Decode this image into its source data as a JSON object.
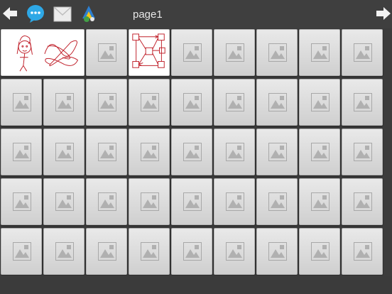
{
  "toolbar": {
    "page_label": "page1",
    "icons": [
      "back-arrow-icon",
      "chat-bubble-icon",
      "mail-icon",
      "share-icon",
      "forward-arrow-icon"
    ],
    "colors": {
      "chat": "#2ea8e6",
      "background": "#3f3f3f"
    }
  },
  "grid": {
    "rows": 5,
    "columns": 9,
    "filled_cells": [
      {
        "row": 0,
        "kind": "drawing-face-and-scribble",
        "span": 2
      },
      {
        "row": 0,
        "kind": "drawing-flow-diagram",
        "span": 1
      }
    ],
    "placeholder_icon": "image-placeholder-icon",
    "ink_color": "#c0202a"
  }
}
